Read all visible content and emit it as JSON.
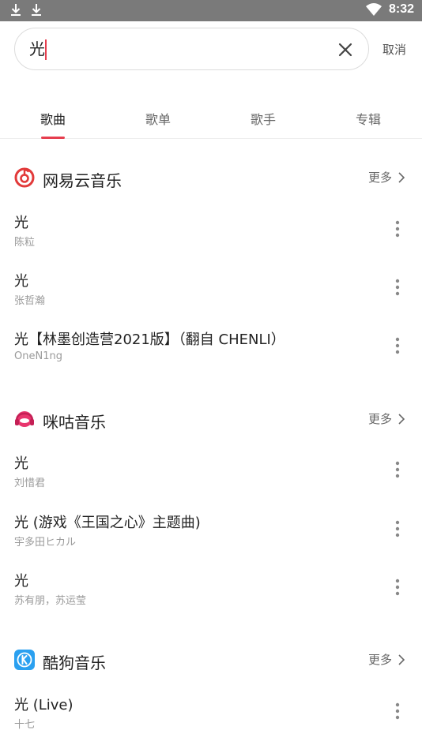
{
  "status_bar": {
    "time": "8:32"
  },
  "search": {
    "query": "光"
  },
  "cancel_label": "取消",
  "tabs": [
    "歌曲",
    "歌单",
    "歌手",
    "专辑"
  ],
  "colors": {
    "accent": "#e63e4e",
    "netease_red": "#e23a3a",
    "migu_pink": "#e8356d",
    "kugou_blue": "#2aa0f0"
  },
  "sections": [
    {
      "name": "网易云音乐",
      "icon": "netease-cloud-music-icon",
      "more": "更多",
      "songs": [
        {
          "title": "光",
          "artist": "陈粒"
        },
        {
          "title": "光",
          "artist": "张哲瀚"
        },
        {
          "title": "光【林墨创造营2021版】（翻自 CHENLI）",
          "artist": "OneN1ng"
        }
      ]
    },
    {
      "name": "咪咕音乐",
      "icon": "migu-music-icon",
      "more": "更多",
      "songs": [
        {
          "title": "光",
          "artist": "刘惜君"
        },
        {
          "title": "光 (游戏《王国之心》主题曲)",
          "artist": "宇多田ヒカル"
        },
        {
          "title": "光",
          "artist": "苏有朋，苏运莹"
        }
      ]
    },
    {
      "name": "酷狗音乐",
      "icon": "kugou-music-icon",
      "more": "更多",
      "songs": [
        {
          "title": "光 (Live)",
          "artist": "十七"
        }
      ]
    }
  ]
}
